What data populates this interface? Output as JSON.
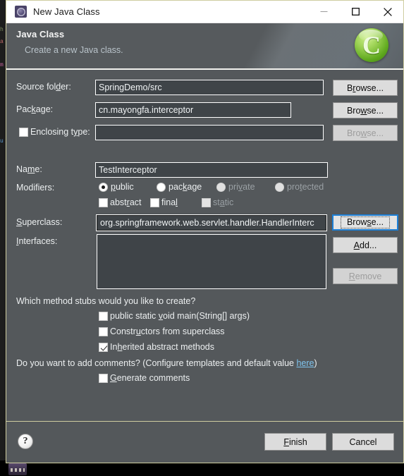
{
  "window": {
    "title": "New Java Class",
    "icon": "java-class-wizard-icon",
    "controls": {
      "minimize": "minimize-icon",
      "maximize": "maximize-icon",
      "close": "close-icon"
    }
  },
  "banner": {
    "title": "Java Class",
    "subtitle": "Create a new Java class.",
    "logo_letter": "C",
    "logo_name": "java-class-banner-icon"
  },
  "form": {
    "source_folder": {
      "label": "Source folder:",
      "value": "SpringDemo/src",
      "button": "Browse..."
    },
    "package": {
      "label": "Package:",
      "value": "cn.mayongfa.interceptor",
      "button": "Browse..."
    },
    "enclosing_type": {
      "label": "Enclosing type:",
      "value": "",
      "checked": false,
      "button": "Browse...",
      "button_disabled": true
    },
    "name": {
      "label": "Name:",
      "value": "TestInterceptor"
    },
    "modifiers": {
      "label": "Modifiers:",
      "radios": [
        {
          "label": "public",
          "selected": true,
          "disabled": false
        },
        {
          "label": "package",
          "selected": false,
          "disabled": false
        },
        {
          "label": "private",
          "selected": false,
          "disabled": true
        },
        {
          "label": "protected",
          "selected": false,
          "disabled": true
        }
      ],
      "checkboxes": [
        {
          "label": "abstract",
          "checked": false,
          "disabled": false
        },
        {
          "label": "final",
          "checked": false,
          "disabled": false
        },
        {
          "label": "static",
          "checked": false,
          "disabled": true
        }
      ]
    },
    "superclass": {
      "label": "Superclass:",
      "value": "org.springframework.web.servlet.handler.HandlerInterc",
      "button": "Browse...",
      "button_focused": true
    },
    "interfaces": {
      "label": "Interfaces:",
      "items": [],
      "add_button": "Add...",
      "remove_button": "Remove",
      "remove_disabled": true
    }
  },
  "stubs": {
    "question": "Which method stubs would you like to create?",
    "options": [
      {
        "label": "public static void main(String[] args)",
        "checked": false
      },
      {
        "label": "Constructors from superclass",
        "checked": false
      },
      {
        "label": "Inherited abstract methods",
        "checked": true
      }
    ]
  },
  "comments": {
    "question_prefix": "Do you want to add comments? (Configure templates and default value ",
    "link": "here",
    "question_suffix": ")",
    "option": {
      "label": "Generate comments",
      "checked": false
    }
  },
  "footer": {
    "help": "?",
    "finish": "Finish",
    "cancel": "Cancel"
  },
  "colors": {
    "dialog_bg": "#54585b",
    "field_bg": "#3f4448",
    "accent_link": "#7fc4ef",
    "focus_blue": "#1c7fd6",
    "banner_logo_green": "#7ec242",
    "border_khaki": "#cfcda0"
  }
}
